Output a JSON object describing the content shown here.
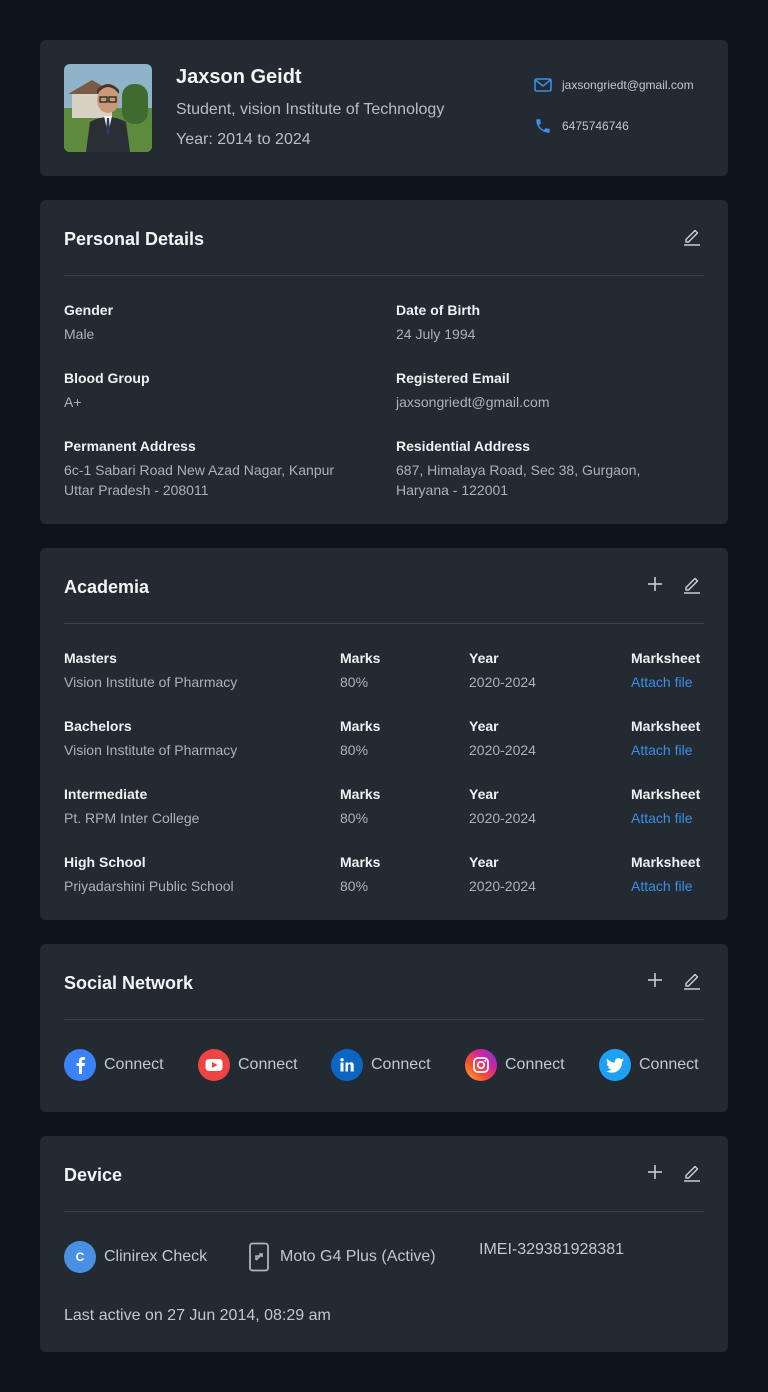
{
  "profile": {
    "name": "Jaxson Geidt",
    "role": "Student, vision Institute of Technology",
    "year": "Year: 2014 to 2024",
    "email": "jaxsongriedt@gmail.com",
    "phone": "6475746746"
  },
  "personal": {
    "title": "Personal Details",
    "gender_label": "Gender",
    "gender": "Male",
    "dob_label": "Date of Birth",
    "dob": "24 July 1994",
    "blood_label": "Blood Group",
    "blood": "A+",
    "email_label": "Registered Email",
    "email": "jaxsongriedt@gmail.com",
    "perm_label": "Permanent Address",
    "perm_line1": "6c-1 Sabari Road New Azad Nagar, Kanpur",
    "perm_line2": "Uttar Pradesh - 208011",
    "res_label": "Residential Address",
    "res_line1": "687, Himalaya Road, Sec 38, Gurgaon,",
    "res_line2": "Haryana - 122001"
  },
  "academia": {
    "title": "Academia",
    "marks_label": "Marks",
    "year_label": "Year",
    "sheet_label": "Marksheet",
    "attach_label": "Attach file",
    "rows": [
      {
        "level": "Masters",
        "institute": "Vision Institute of Pharmacy",
        "marks": "80%",
        "year": "2020-2024"
      },
      {
        "level": "Bachelors",
        "institute": "Vision Institute of Pharmacy",
        "marks": "80%",
        "year": "2020-2024"
      },
      {
        "level": "Intermediate",
        "institute": "Pt. RPM Inter College",
        "marks": "80%",
        "year": "2020-2024"
      },
      {
        "level": "High School",
        "institute": "Priyadarshini Public School",
        "marks": "80%",
        "year": "2020-2024"
      }
    ]
  },
  "social": {
    "title": "Social Network",
    "items": [
      {
        "label": "Connect",
        "icon": "facebook-icon",
        "color": "#3b82f6"
      },
      {
        "label": "Connect",
        "icon": "youtube-icon",
        "color": "#ef4444"
      },
      {
        "label": "Connect",
        "icon": "linkedin-icon",
        "color": "#0a66c2"
      },
      {
        "label": "Connect",
        "icon": "instagram-icon",
        "color": "#d6249f"
      },
      {
        "label": "Connect",
        "icon": "twitter-icon",
        "color": "#1da1f2"
      }
    ]
  },
  "device": {
    "title": "Device",
    "app_initial": "C",
    "app_name": "Clinirex Check",
    "model": "Moto G4 Plus (Active)",
    "imei": "IMEI-329381928381",
    "last_active": "Last active on 27 Jun 2014, 08:29 am"
  },
  "colors": {
    "accent": "#3b8fe8",
    "card": "#232a31",
    "background": "#0f141b"
  }
}
